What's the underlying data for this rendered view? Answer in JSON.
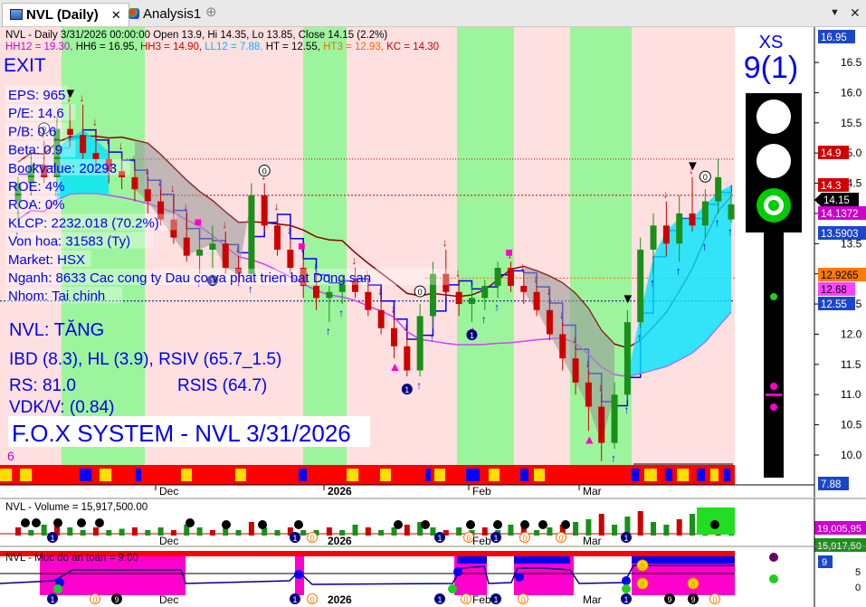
{
  "tabs": [
    {
      "label": "NVL (Daily)",
      "close": "✕",
      "active": true
    },
    {
      "label": "Analysis1",
      "close": "",
      "active": false
    }
  ],
  "add_tab_icon": "plus-circle-icon",
  "window_buttons": {
    "dropdown": "▼",
    "close": "✕"
  },
  "header": {
    "line1": "NVL - Daily 3/31/2026 00:00:00 Open 13.9, Hi 14.35, Lo 13.85, Close 14.15 (2.2%)",
    "line2": [
      {
        "text": "HH12 = 19.30, ",
        "color": "#cc00cc"
      },
      {
        "text": "HH6 = 16.95, ",
        "color": "#000000"
      },
      {
        "text": "HH3 = 14.90, ",
        "color": "#cc0000"
      },
      {
        "text": "LL12 = 7.88, ",
        "color": "#00b7ff"
      },
      {
        "text": "HT  = 12.55, ",
        "color": "#000000"
      },
      {
        "text": "HT3  = 12.93, ",
        "color": "#ff6600"
      },
      {
        "text": "KC = 14.30",
        "color": "#cc0000"
      }
    ]
  },
  "overlay": {
    "exit": "EXIT",
    "fundamentals": [
      "EPS: 965",
      "P/E: 14.6",
      "P/B: 0.6",
      "Beta: 0.9",
      "Bookvalue: 20293",
      "ROE: 4%",
      "ROA: 0%",
      "KLCP: 2232.018 (70.2%)",
      "Von hoa: 31583 (Ty)",
      "Market: HSX",
      "Nganh: 8633 Cac cong ty Dau co va phat trien bat Dong san",
      "Nhom: Tai chinh"
    ],
    "trend": "NVL: TĂNG",
    "ibd": "IBD (8.3), HL (3.9), RSIV (65.7_1.5)",
    "rs": "RS: 81.0",
    "rsis": "RSIS (64.7)",
    "vdk": "VDK/V:  (0.84)",
    "fox": "F.O.X SYSTEM - NVL 3/31/2026",
    "small_num": "6"
  },
  "signal": {
    "label": "XS",
    "value": "9(1)"
  },
  "colors": {
    "up": "#1a8f1a",
    "down": "#cc0000",
    "green_zone": "#9cf59c",
    "pink_zone": "#ffe0e0",
    "price_line": "#0000ee",
    "kc_line": "#8b0000",
    "lower_line": "#cc44ff",
    "cyan": "#00e5ff",
    "magenta": "#ff00cc",
    "navy": "#000080"
  },
  "chart_data": {
    "type": "candlestick",
    "x_labels": [
      "Dec",
      "2026",
      "Feb",
      "Mar"
    ],
    "y_ticks": [
      "16.5",
      "16.0",
      "15.5",
      "15.0",
      "14.5",
      "14.0",
      "13.5",
      "13.0",
      "12.5",
      "12.0",
      "11.5",
      "11.0",
      "10.5",
      "10.0"
    ],
    "ylim": [
      9.7,
      16.95
    ],
    "price_tags": [
      {
        "text": "16.95",
        "value": 16.95,
        "bg": "#1c46c8",
        "fg": "#ffffff"
      },
      {
        "text": "14.9",
        "value": 14.9,
        "bg": "#d00000",
        "fg": "#ffffff"
      },
      {
        "text": "14.3",
        "value": 14.3,
        "bg": "#d00000",
        "fg": "#ffffff"
      },
      {
        "text": "14.15",
        "value": 14.15,
        "bg": "#000000",
        "fg": "#ffffff"
      },
      {
        "text": "14.1372",
        "value": 14.1372,
        "bg": "#cc00cc",
        "fg": "#ffffff"
      },
      {
        "text": "13.5903",
        "value": 13.5903,
        "bg": "#1c46c8",
        "fg": "#ffffff"
      },
      {
        "text": "12.9265",
        "value": 12.9265,
        "bg": "#ff7a00",
        "fg": "#000000"
      },
      {
        "text": "12.68",
        "value": 12.68,
        "bg": "#ff44ff",
        "fg": "#000000"
      },
      {
        "text": "12.55",
        "value": 12.55,
        "bg": "#1c46c8",
        "fg": "#ffffff"
      },
      {
        "text": "7.88",
        "value": 7.88,
        "bg": "#1c46c8",
        "fg": "#ffffff"
      }
    ],
    "candles": [
      [
        14.2,
        14.6,
        13.8,
        14.5
      ],
      [
        14.5,
        15.0,
        14.3,
        14.8
      ],
      [
        14.8,
        15.2,
        14.5,
        14.6
      ],
      [
        14.6,
        15.6,
        14.5,
        15.4
      ],
      [
        15.4,
        15.8,
        15.1,
        15.3
      ],
      [
        15.3,
        15.8,
        14.9,
        15.0
      ],
      [
        15.0,
        15.4,
        14.7,
        14.9
      ],
      [
        14.9,
        15.1,
        14.5,
        14.7
      ],
      [
        14.7,
        15.0,
        14.4,
        14.6
      ],
      [
        14.6,
        14.8,
        14.2,
        14.4
      ],
      [
        14.4,
        14.6,
        14.0,
        14.2
      ],
      [
        14.2,
        14.4,
        13.8,
        13.9
      ],
      [
        13.9,
        14.3,
        13.5,
        13.6
      ],
      [
        13.6,
        14.0,
        13.2,
        13.3
      ],
      [
        13.3,
        13.7,
        13.0,
        13.4
      ],
      [
        13.4,
        13.8,
        13.1,
        13.5
      ],
      [
        13.5,
        13.7,
        13.0,
        13.1
      ],
      [
        13.1,
        13.3,
        12.8,
        13.0
      ],
      [
        13.0,
        14.5,
        12.9,
        14.3
      ],
      [
        14.3,
        14.5,
        13.7,
        13.8
      ],
      [
        13.8,
        14.0,
        13.3,
        13.4
      ],
      [
        13.4,
        13.6,
        13.0,
        13.1
      ],
      [
        13.1,
        13.3,
        12.6,
        12.8
      ],
      [
        12.8,
        13.0,
        12.4,
        12.6
      ],
      [
        12.6,
        12.8,
        12.2,
        12.7
      ],
      [
        12.7,
        13.0,
        12.5,
        12.9
      ],
      [
        12.9,
        13.1,
        12.6,
        12.7
      ],
      [
        12.7,
        12.9,
        12.3,
        12.4
      ],
      [
        12.4,
        12.6,
        12.0,
        12.1
      ],
      [
        12.1,
        12.3,
        11.6,
        11.8
      ],
      [
        11.8,
        12.0,
        11.3,
        11.4
      ],
      [
        11.4,
        12.5,
        11.3,
        12.3
      ],
      [
        12.3,
        13.2,
        12.1,
        13.0
      ],
      [
        13.0,
        13.4,
        12.6,
        12.7
      ],
      [
        12.7,
        12.9,
        12.3,
        12.5
      ],
      [
        12.5,
        12.8,
        12.2,
        12.6
      ],
      [
        12.6,
        12.9,
        12.4,
        12.8
      ],
      [
        12.8,
        13.2,
        12.6,
        13.1
      ],
      [
        13.1,
        13.2,
        12.7,
        12.8
      ],
      [
        12.8,
        13.0,
        12.5,
        12.7
      ],
      [
        12.7,
        12.8,
        12.3,
        12.4
      ],
      [
        12.4,
        12.6,
        11.9,
        12.0
      ],
      [
        12.0,
        12.2,
        11.4,
        11.6
      ],
      [
        11.6,
        11.8,
        11.0,
        11.2
      ],
      [
        11.2,
        11.4,
        10.4,
        10.8
      ],
      [
        10.8,
        11.0,
        9.9,
        10.2
      ],
      [
        10.2,
        11.2,
        10.1,
        11.0
      ],
      [
        11.0,
        12.4,
        10.9,
        12.2
      ],
      [
        12.2,
        13.6,
        12.1,
        13.4
      ],
      [
        13.4,
        14.0,
        13.0,
        13.8
      ],
      [
        13.8,
        14.2,
        13.3,
        13.5
      ],
      [
        13.5,
        14.3,
        13.2,
        14.0
      ],
      [
        14.0,
        14.6,
        13.7,
        13.8
      ],
      [
        13.8,
        14.4,
        13.6,
        14.2
      ],
      [
        14.2,
        14.9,
        14.0,
        14.6
      ],
      [
        13.9,
        14.35,
        13.85,
        14.15
      ]
    ],
    "volume": {
      "label": "NVL - Volume = 15,917,500.00",
      "tags": [
        {
          "text": "19,005,95",
          "bg": "#cc00cc"
        },
        {
          "text": "15,917,50",
          "bg": "#1a8f1a"
        }
      ]
    },
    "safety": {
      "label": "NVL - Muc do an toan = 9.00",
      "value_tag": "9",
      "ticks": [
        "5",
        "0"
      ]
    }
  }
}
